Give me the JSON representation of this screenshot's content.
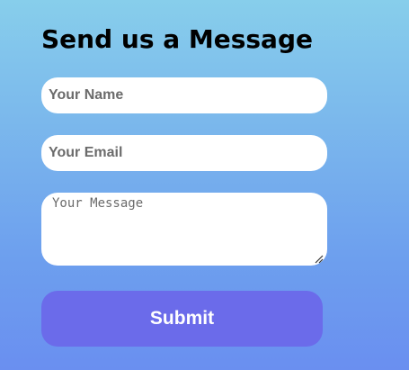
{
  "form": {
    "title": "Send us a Message",
    "name_placeholder": "Your Name",
    "email_placeholder": "Your Email",
    "message_placeholder": "Your Message",
    "submit_label": "Submit"
  },
  "colors": {
    "background_top": "#87ceeb",
    "background_bottom": "#6a8ff0",
    "submit_button": "#6b6bea",
    "input_background": "#ffffff"
  }
}
